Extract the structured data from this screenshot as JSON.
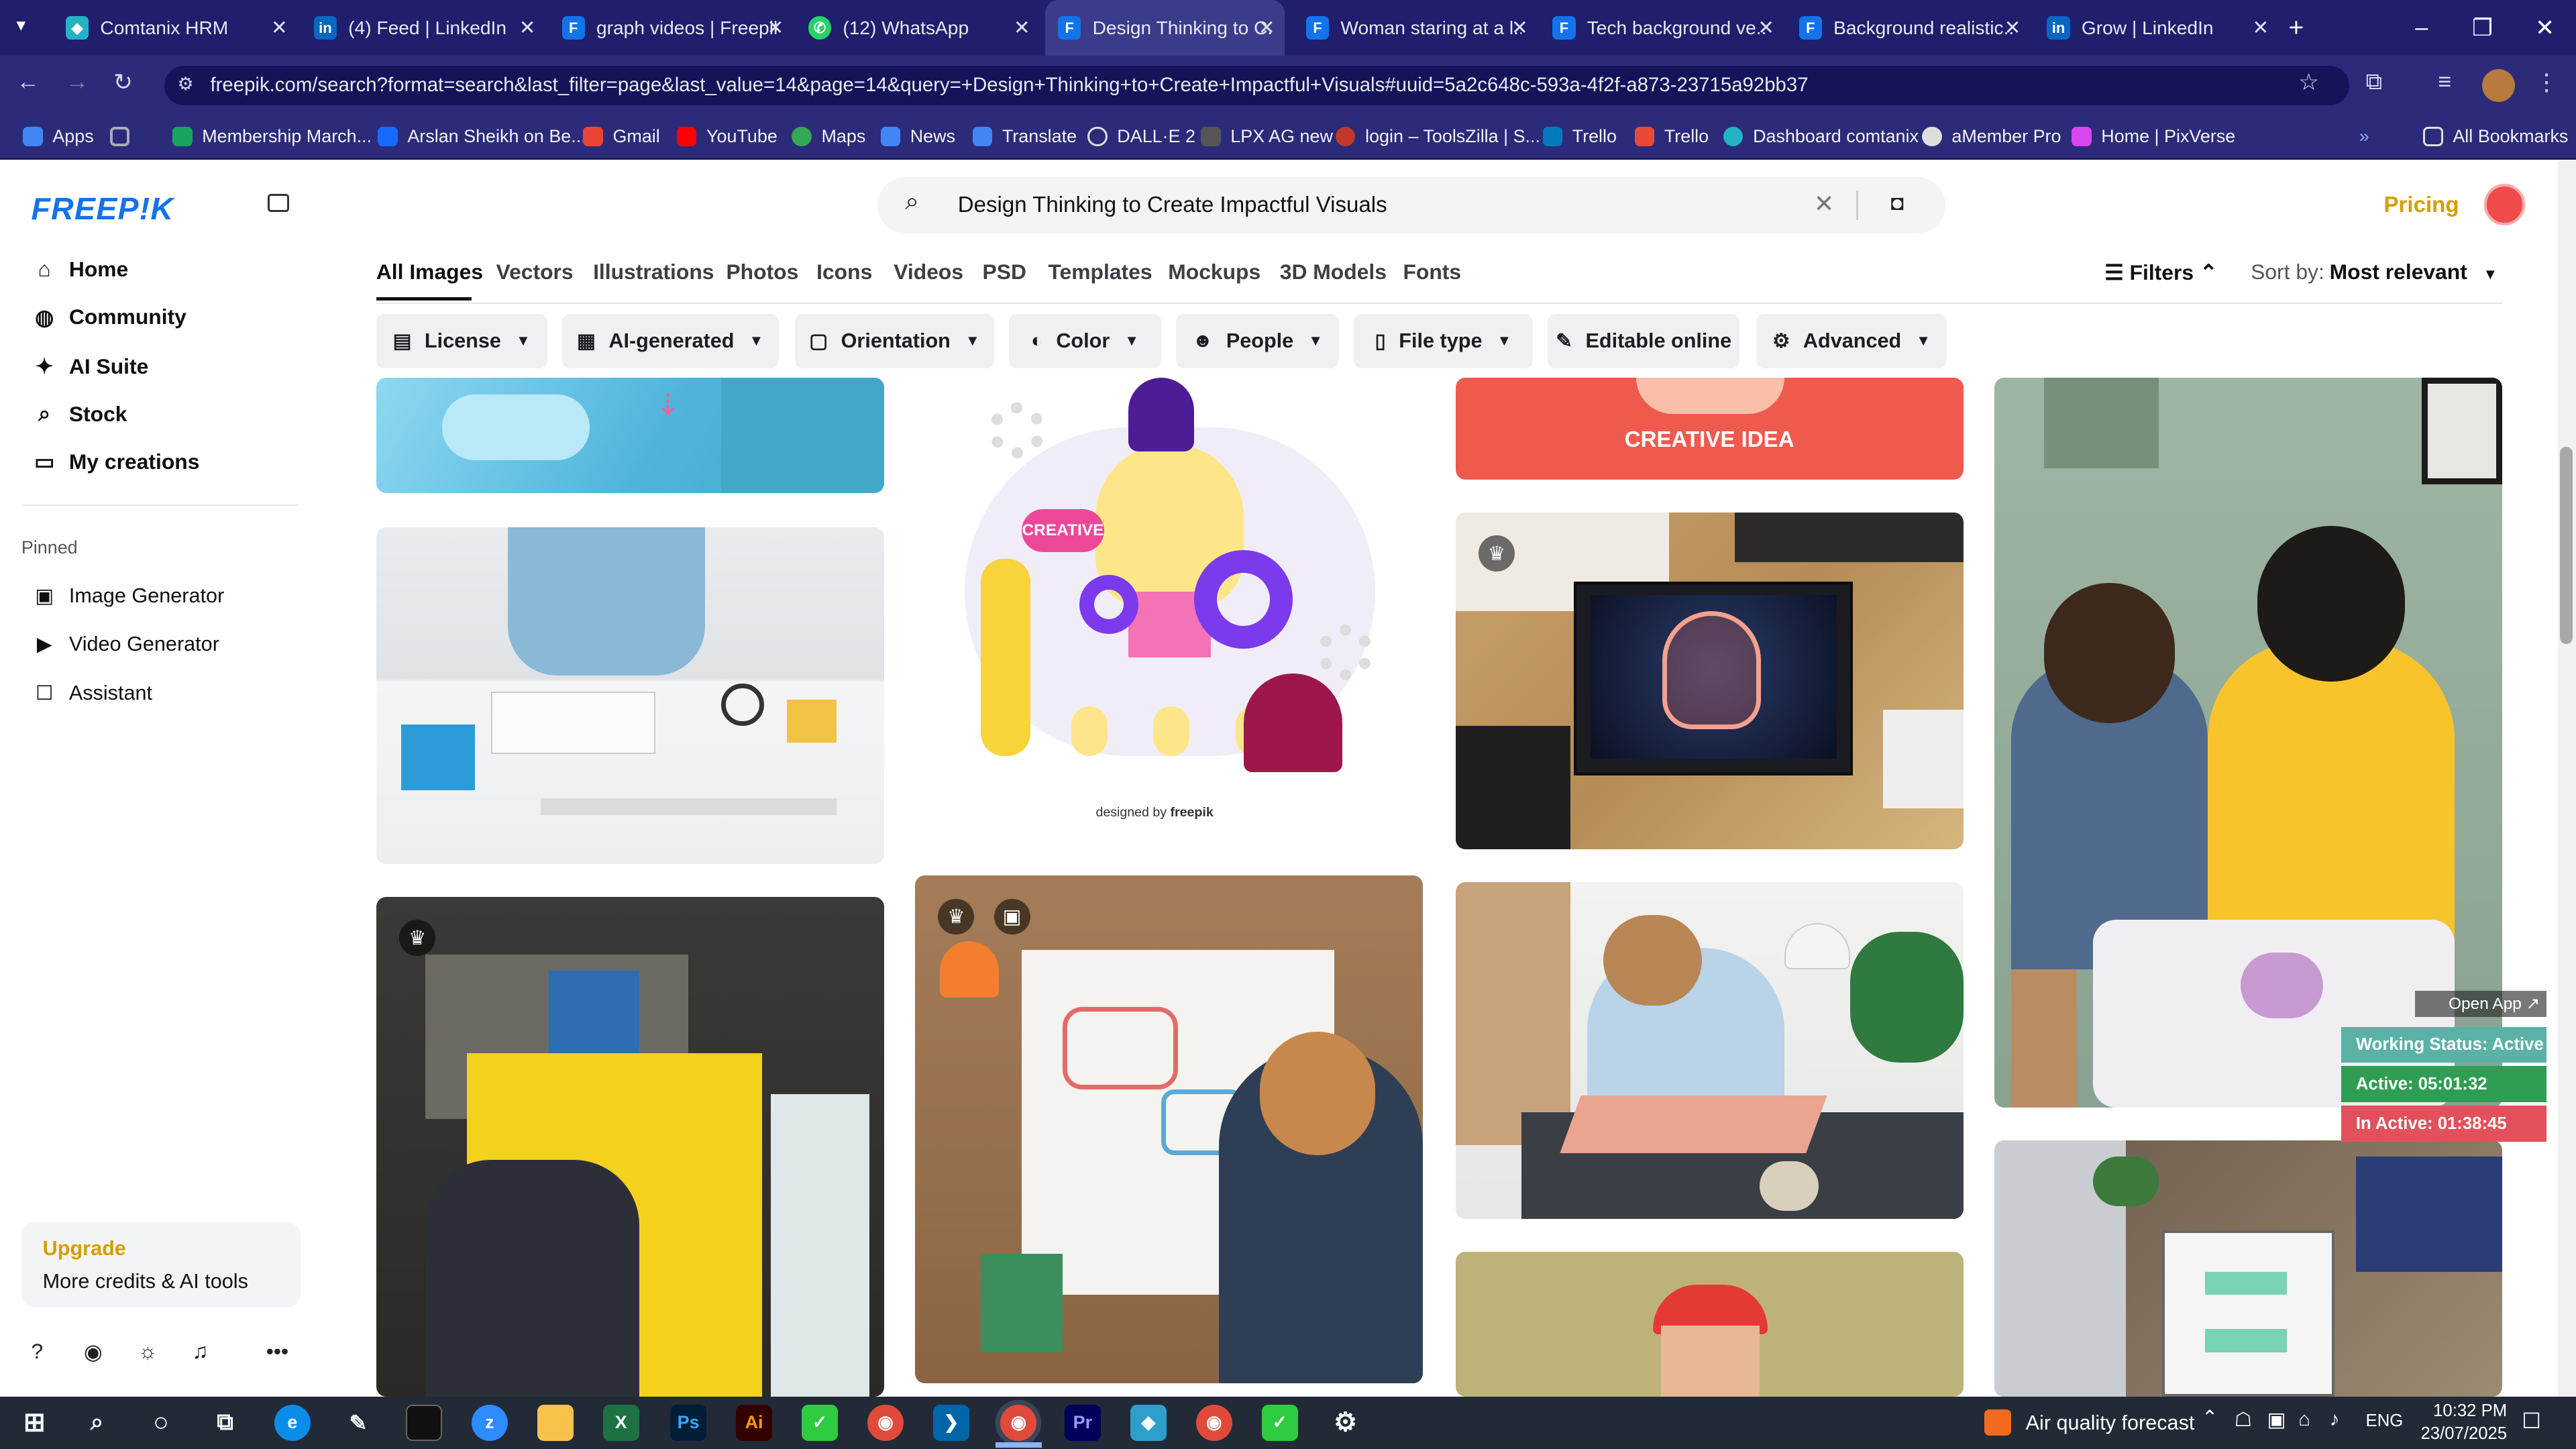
{
  "browser": {
    "tabs": [
      {
        "label": "Comtanix HRM"
      },
      {
        "label": "(4) Feed | LinkedIn"
      },
      {
        "label": "graph videos | Freepik"
      },
      {
        "label": "(12) WhatsApp"
      },
      {
        "label": "Design Thinking to C..."
      },
      {
        "label": "Woman staring at a l..."
      },
      {
        "label": "Tech background ve..."
      },
      {
        "label": "Background realistic..."
      },
      {
        "label": "Grow | LinkedIn"
      }
    ],
    "url": "freepik.com/search?format=search&last_filter=page&last_value=14&page=14&query=+Design+Thinking+to+Create+Impactful+Visuals#uuid=5a2c648c-593a-4f2f-a873-23715a92bb37",
    "bookmarks": [
      "Apps",
      "Membership March...",
      "Arslan Sheikh on Be...",
      "Gmail",
      "YouTube",
      "Maps",
      "News",
      "Translate",
      "DALL·E 2",
      "LPX AG new",
      "login – ToolsZilla | S...",
      "Trello",
      "Trello",
      "Dashboard comtanix",
      "aMember Pro",
      "Home | PixVerse"
    ],
    "all_bookmarks": "All Bookmarks"
  },
  "sidebar": {
    "logo": "FREEP!K",
    "items": [
      {
        "label": "Home"
      },
      {
        "label": "Community"
      },
      {
        "label": "AI Suite"
      },
      {
        "label": "Stock"
      },
      {
        "label": "My creations"
      }
    ],
    "pinned_heading": "Pinned",
    "pinned": [
      {
        "label": "Image Generator"
      },
      {
        "label": "Video Generator"
      },
      {
        "label": "Assistant"
      }
    ],
    "upgrade_title": "Upgrade",
    "upgrade_sub": "More credits & AI tools"
  },
  "header": {
    "search_value": "Design Thinking to Create Impactful Visuals",
    "pricing": "Pricing"
  },
  "categories": [
    "All Images",
    "Vectors",
    "Illustrations",
    "Photos",
    "Icons",
    "Videos",
    "PSD",
    "Templates",
    "Mockups",
    "3D Models",
    "Fonts"
  ],
  "filters_label": "Filters",
  "sort_label": "Sort by:",
  "sort_value": "Most relevant",
  "filter_chips": [
    "License",
    "AI-generated",
    "Orientation",
    "Color",
    "People",
    "File type",
    "Editable online",
    "Advanced"
  ],
  "tiles": {
    "creative_idea_text": "CREATIVE IDEA",
    "creative_label": "CREATIVE",
    "designed_by": "designed by",
    "brand": "freepik"
  },
  "status_widget": {
    "open_app": "Open App ↗",
    "working": "Working Status: Active",
    "active": "Active: 05:01:32",
    "inactive": "In Active: 01:38:45"
  },
  "taskbar": {
    "air_quality": "Air quality forecast",
    "lang": "ENG",
    "time": "10:32 PM",
    "date": "23/07/2025"
  }
}
